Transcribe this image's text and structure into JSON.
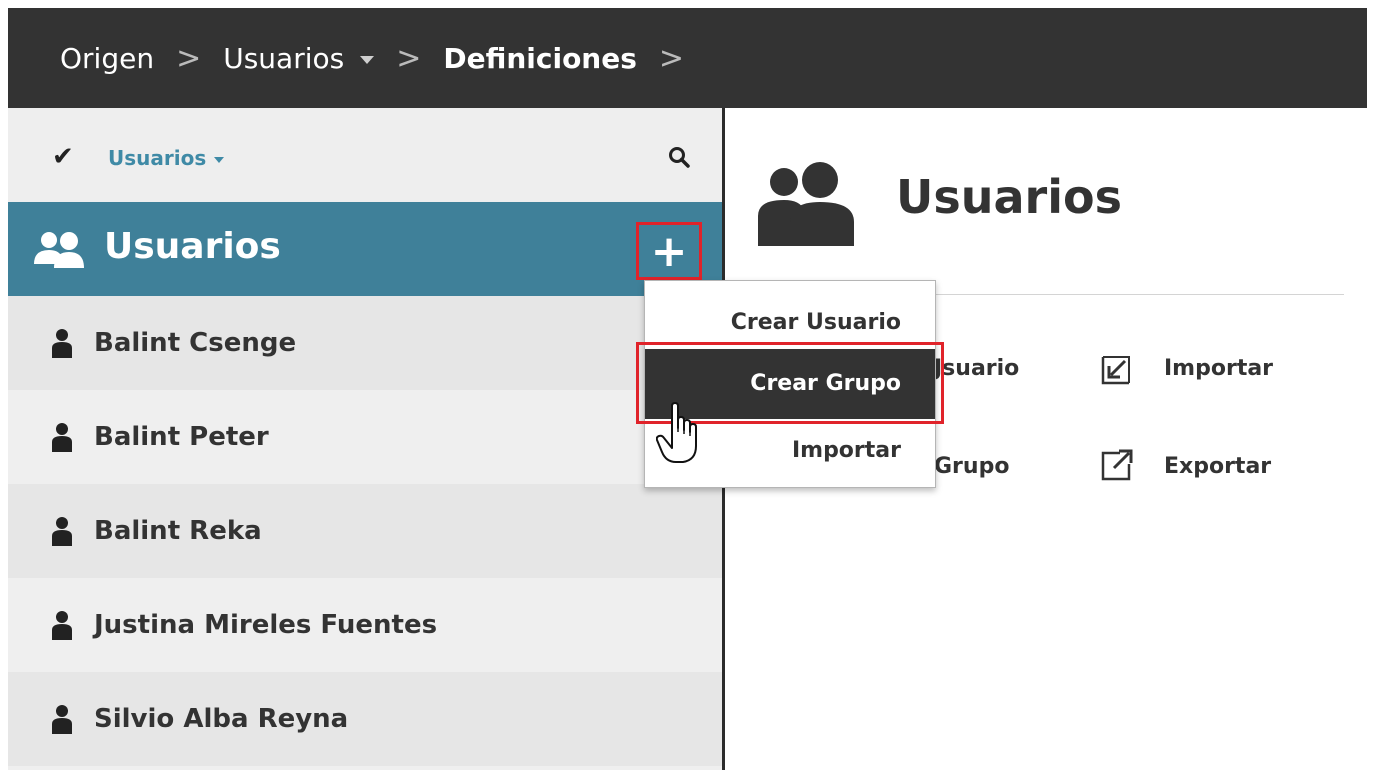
{
  "breadcrumb": {
    "items": [
      "Origen",
      "Usuarios",
      "Definiciones"
    ],
    "separator": ">"
  },
  "sidebar": {
    "filter": {
      "check": "✔",
      "label": "Usuarios"
    },
    "header": {
      "label": "Usuarios",
      "add_label": "+"
    },
    "users": [
      "Balint Csenge",
      "Balint Peter",
      "Balint Reka",
      "Justina Mireles Fuentes",
      "Silvio Alba Reyna"
    ]
  },
  "main": {
    "title": "Usuarios",
    "actions": {
      "create_user": "Jsuario",
      "create_group": "Grupo",
      "import": "Importar",
      "export": "Exportar"
    }
  },
  "menu": {
    "items": [
      "Crear Usuario",
      "Crear Grupo",
      "Importar"
    ],
    "selected": "Crear Grupo"
  },
  "colors": {
    "topbar": "#333333",
    "accent": "#3f8099",
    "highlight": "#e0232a"
  }
}
